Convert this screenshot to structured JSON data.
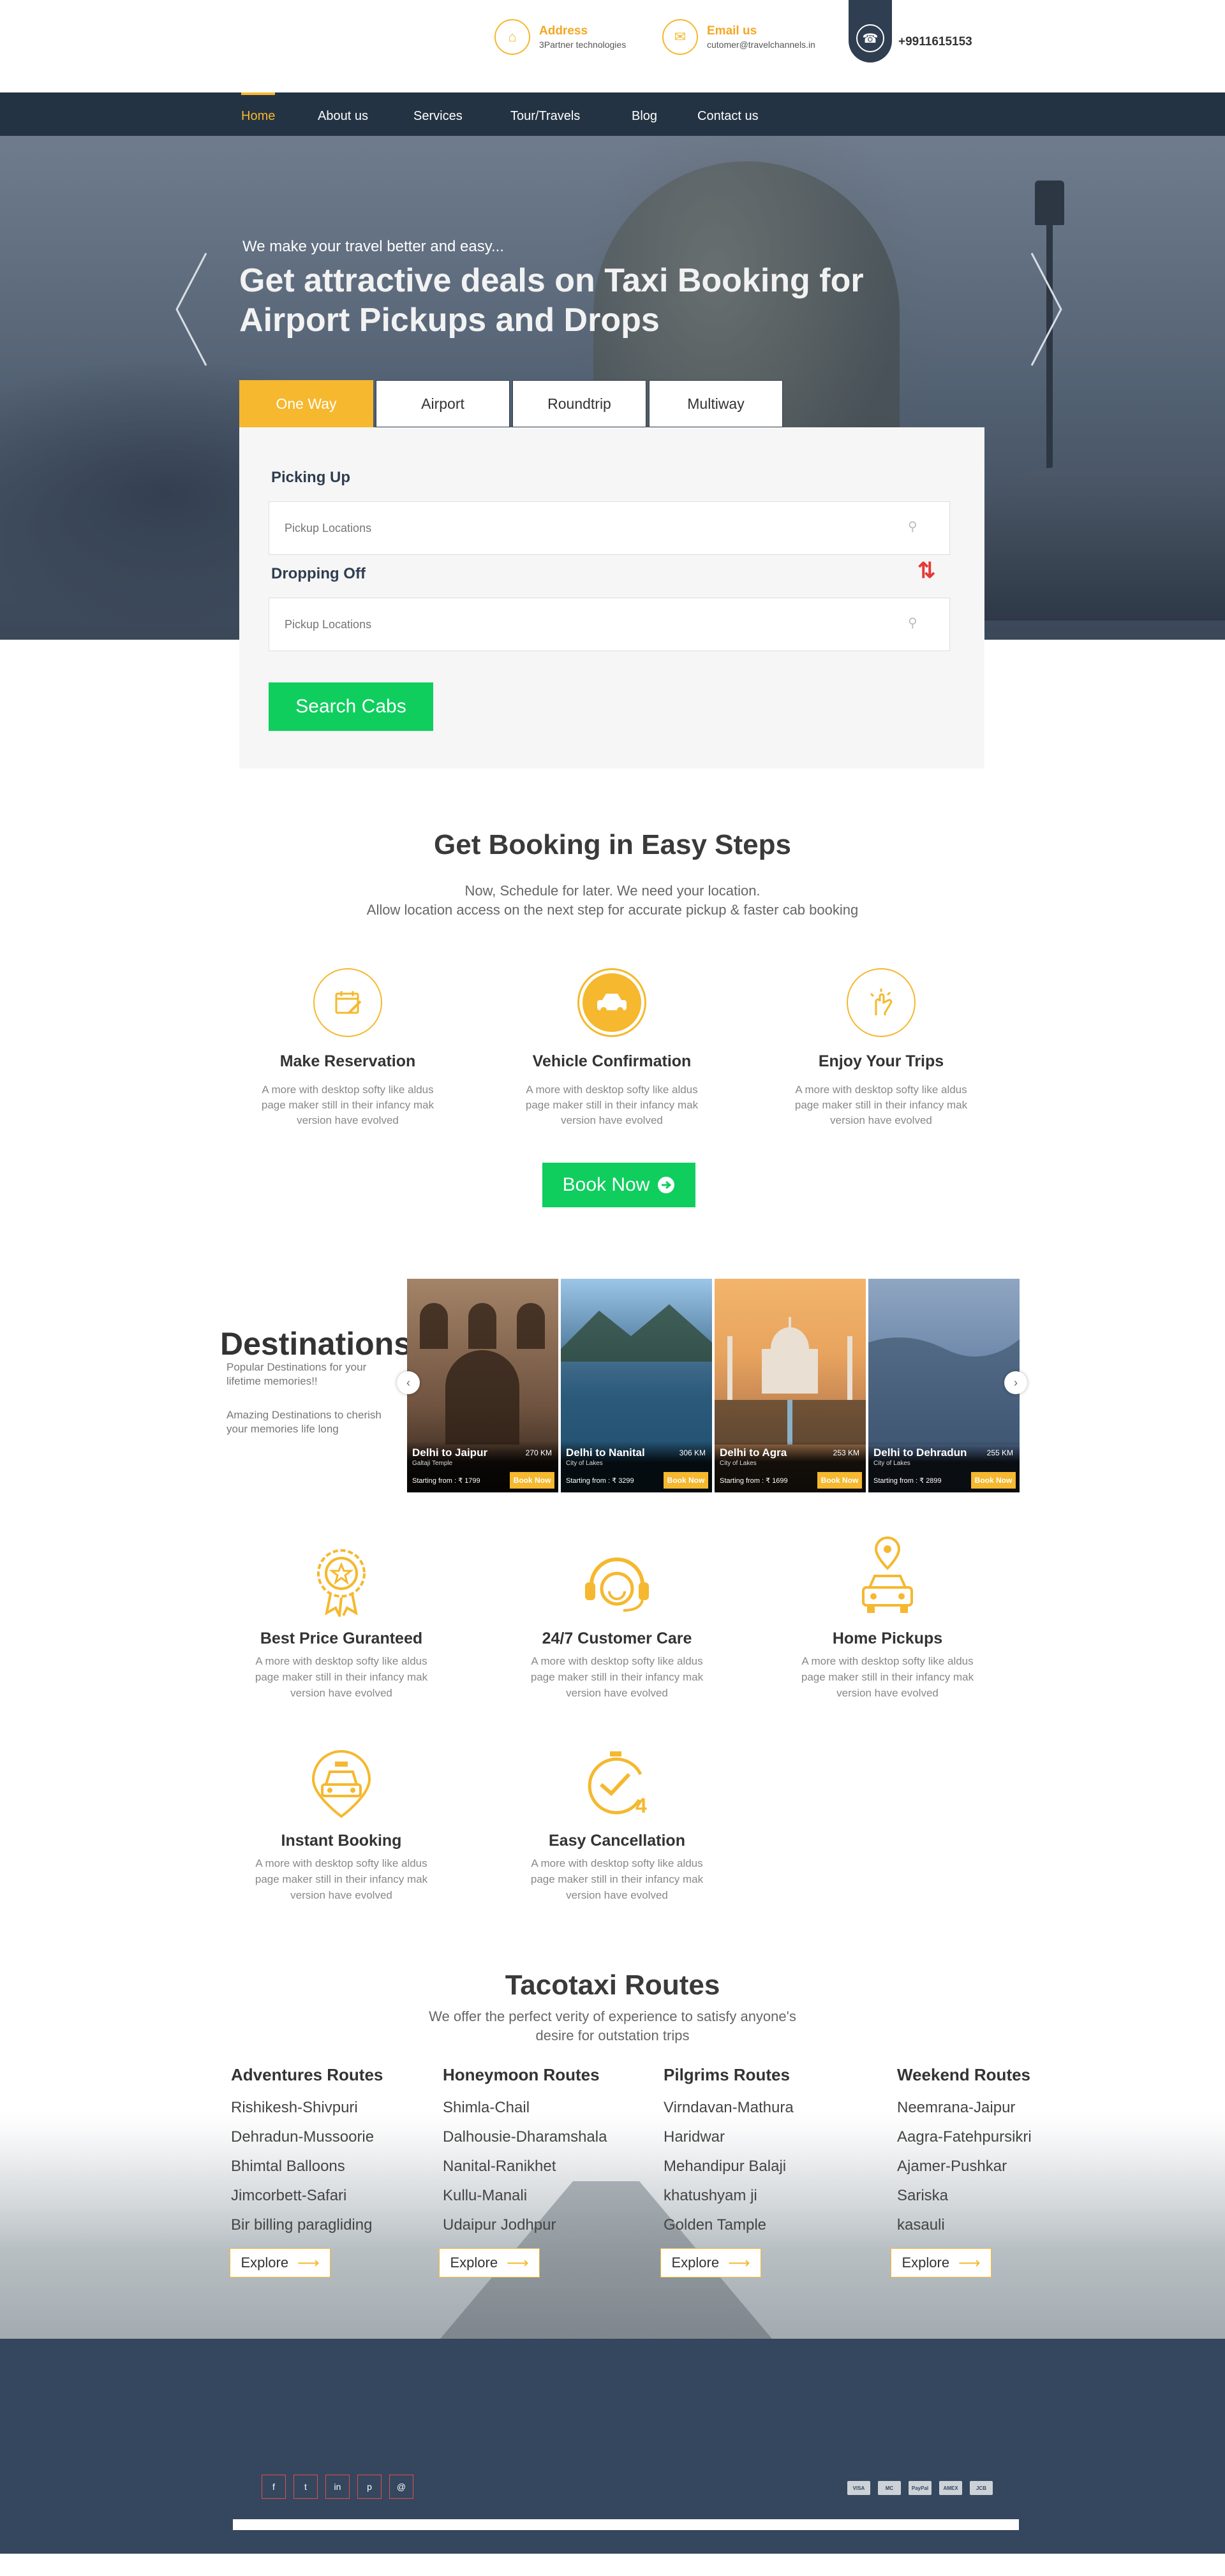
{
  "topbar": {
    "address_label": "Address",
    "address_value": "3Partner technologies",
    "email_label": "Email us",
    "email_value": "cutomer@travelchannels.in",
    "phone": "+9911615153"
  },
  "nav": {
    "items": [
      "Home",
      "About us",
      "Services",
      "Tour/Travels",
      "Blog",
      "Contact us"
    ],
    "active": "Home"
  },
  "hero": {
    "subtitle": "We make your travel better and easy...",
    "title": "Get attractive deals on Taxi Booking for Airport Pickups and Drops"
  },
  "booking": {
    "tabs": [
      "One Way",
      "Airport",
      "Roundtrip",
      "Multiway"
    ],
    "active_tab": "One Way",
    "pickup_label": "Picking Up",
    "pickup_placeholder": "Pickup Locations",
    "drop_label": "Dropping Off",
    "drop_placeholder": "Pickup Locations",
    "search_button": "Search Cabs"
  },
  "steps": {
    "title": "Get Booking in Easy Steps",
    "line1": "Now, Schedule for later. We need your location.",
    "line2": "Allow location access on the next step for accurate pickup & faster cab booking",
    "items": [
      {
        "title": "Make Reservation",
        "desc": "A more with desktop softy like aldus page maker still in their infancy mak version have evolved",
        "icon": "calendar-icon"
      },
      {
        "title": "Vehicle Confirmation",
        "desc": "A more with desktop softy like aldus page maker still in their infancy mak version have evolved",
        "icon": "taxi-icon"
      },
      {
        "title": "Enjoy Your Trips",
        "desc": "A more with desktop softy like aldus page maker still in their infancy mak version have evolved",
        "icon": "hand-icon"
      }
    ],
    "book_button": "Book Now"
  },
  "destinations": {
    "title": "Destinations",
    "text1": "Popular Destinations for your lifetime memories!!",
    "text2": "Amazing Destinations to cherish your memories life long",
    "cards": [
      {
        "name": "Delhi to Jaipur",
        "sub": "Galtaji Temple",
        "km": "270 KM",
        "price": "Starting from : ₹ 1799",
        "book": "Book Now"
      },
      {
        "name": "Delhi to Nanital",
        "sub": "City of Lakes",
        "km": "306 KM",
        "price": "Starting from : ₹ 3299",
        "book": "Book Now"
      },
      {
        "name": "Delhi to Agra",
        "sub": "City of Lakes",
        "km": "253 KM",
        "price": "Starting from : ₹ 1699",
        "book": "Book Now"
      },
      {
        "name": "Delhi to Dehradun",
        "sub": "City of Lakes",
        "km": "255 KM",
        "price": "Starting from : ₹ 2899",
        "book": "Book Now"
      }
    ]
  },
  "features": [
    {
      "title": "Best Price Guranteed",
      "desc": "A more with desktop softy like aldus page maker still in their infancy mak version have evolved"
    },
    {
      "title": "24/7 Customer Care",
      "desc": "A more with desktop softy like aldus page maker still in their infancy mak version have evolved"
    },
    {
      "title": "Home Pickups",
      "desc": "A more with desktop softy like aldus page maker still in their infancy mak version have evolved"
    },
    {
      "title": "Instant Booking",
      "desc": "A more with desktop softy like aldus page maker still in their infancy mak version have evolved"
    },
    {
      "title": "Easy Cancellation",
      "desc": "A more with desktop softy like aldus page maker still in their infancy mak version have evolved"
    }
  ],
  "routes": {
    "title": "Tacotaxi Routes",
    "subtitle1": "We offer the perfect verity of experience to satisfy anyone's",
    "subtitle2": "desire for outstation trips",
    "columns": [
      {
        "title": "Adventures Routes",
        "items": [
          "Rishikesh-Shivpuri",
          "Dehradun-Mussoorie",
          "Bhimtal  Balloons",
          "Jimcorbett-Safari",
          "Bir billing paragliding"
        ]
      },
      {
        "title": "Honeymoon Routes",
        "items": [
          "Shimla-Chail",
          "Dalhousie-Dharamshala",
          "Nanital-Ranikhet",
          "Kullu-Manali",
          "Udaipur Jodhpur"
        ]
      },
      {
        "title": "Pilgrims Routes",
        "items": [
          "Virndavan-Mathura",
          "Haridwar",
          "Mehandipur Balaji",
          "khatushyam ji",
          "Golden Tample"
        ]
      },
      {
        "title": "Weekend Routes",
        "items": [
          "Neemrana-Jaipur",
          "Aagra-Fatehpursikri",
          "Ajamer-Pushkar",
          "Sariska",
          "kasauli"
        ]
      }
    ],
    "explore": "Explore"
  },
  "footer": {
    "social": [
      "f",
      "t",
      "in",
      "p",
      "@"
    ],
    "payments": [
      "VISA",
      "MC",
      "PayPal",
      "AMEX",
      "JCB"
    ]
  },
  "colors": {
    "accent": "#f5b82e",
    "nav": "#243343",
    "green": "#0fce5e",
    "footer": "#35475e"
  }
}
